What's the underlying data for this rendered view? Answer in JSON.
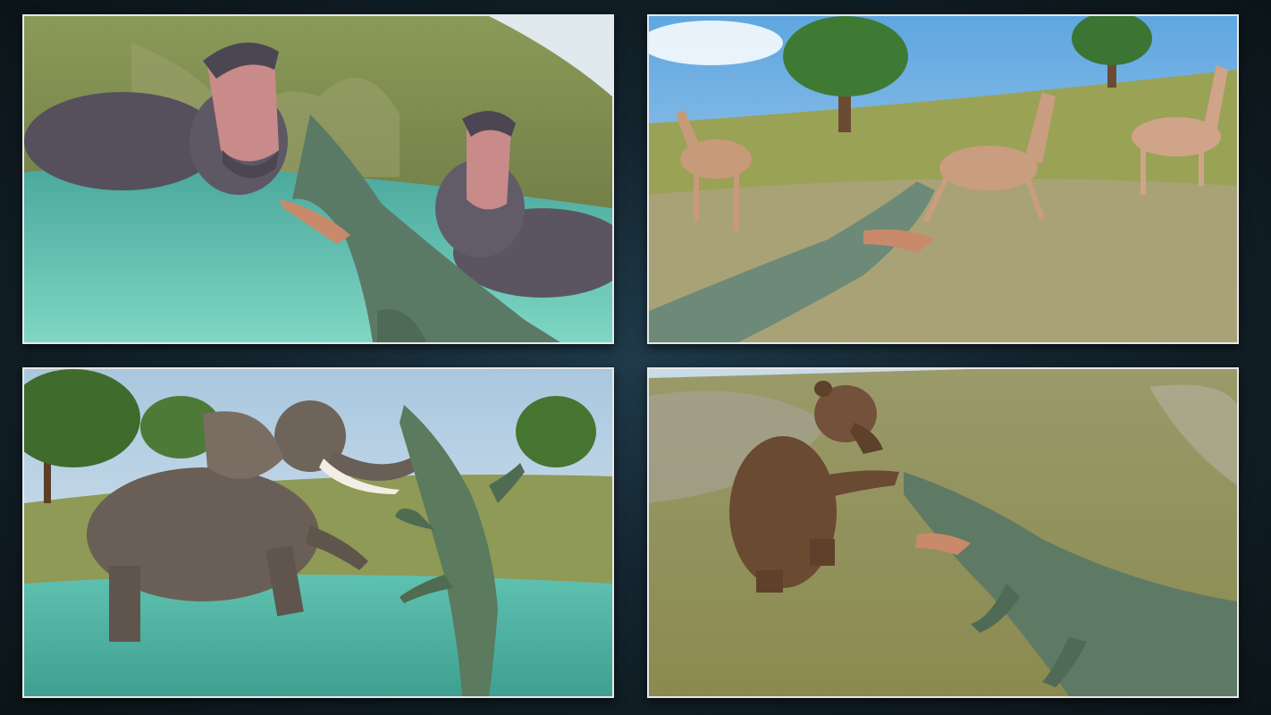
{
  "gallery": {
    "layout": "2x2 grid",
    "panels": [
      {
        "scene": "crocodile-vs-hippos-in-water"
      },
      {
        "scene": "crocodile-hunting-deer-in-grassland"
      },
      {
        "scene": "crocodile-vs-elephant-in-river"
      },
      {
        "scene": "crocodile-vs-bear-on-hillside"
      }
    ]
  },
  "colors": {
    "background": "#14242e",
    "frame": "#e8e8e8",
    "sky": "#7fb8e6",
    "water": "#5cc4b0",
    "grass": "#8f9a4a",
    "crocodile": "#5b7a66",
    "hippo": "#5a5560",
    "deer": "#c79a7a",
    "elephant": "#6a5f56",
    "bear": "#6b4a32"
  }
}
